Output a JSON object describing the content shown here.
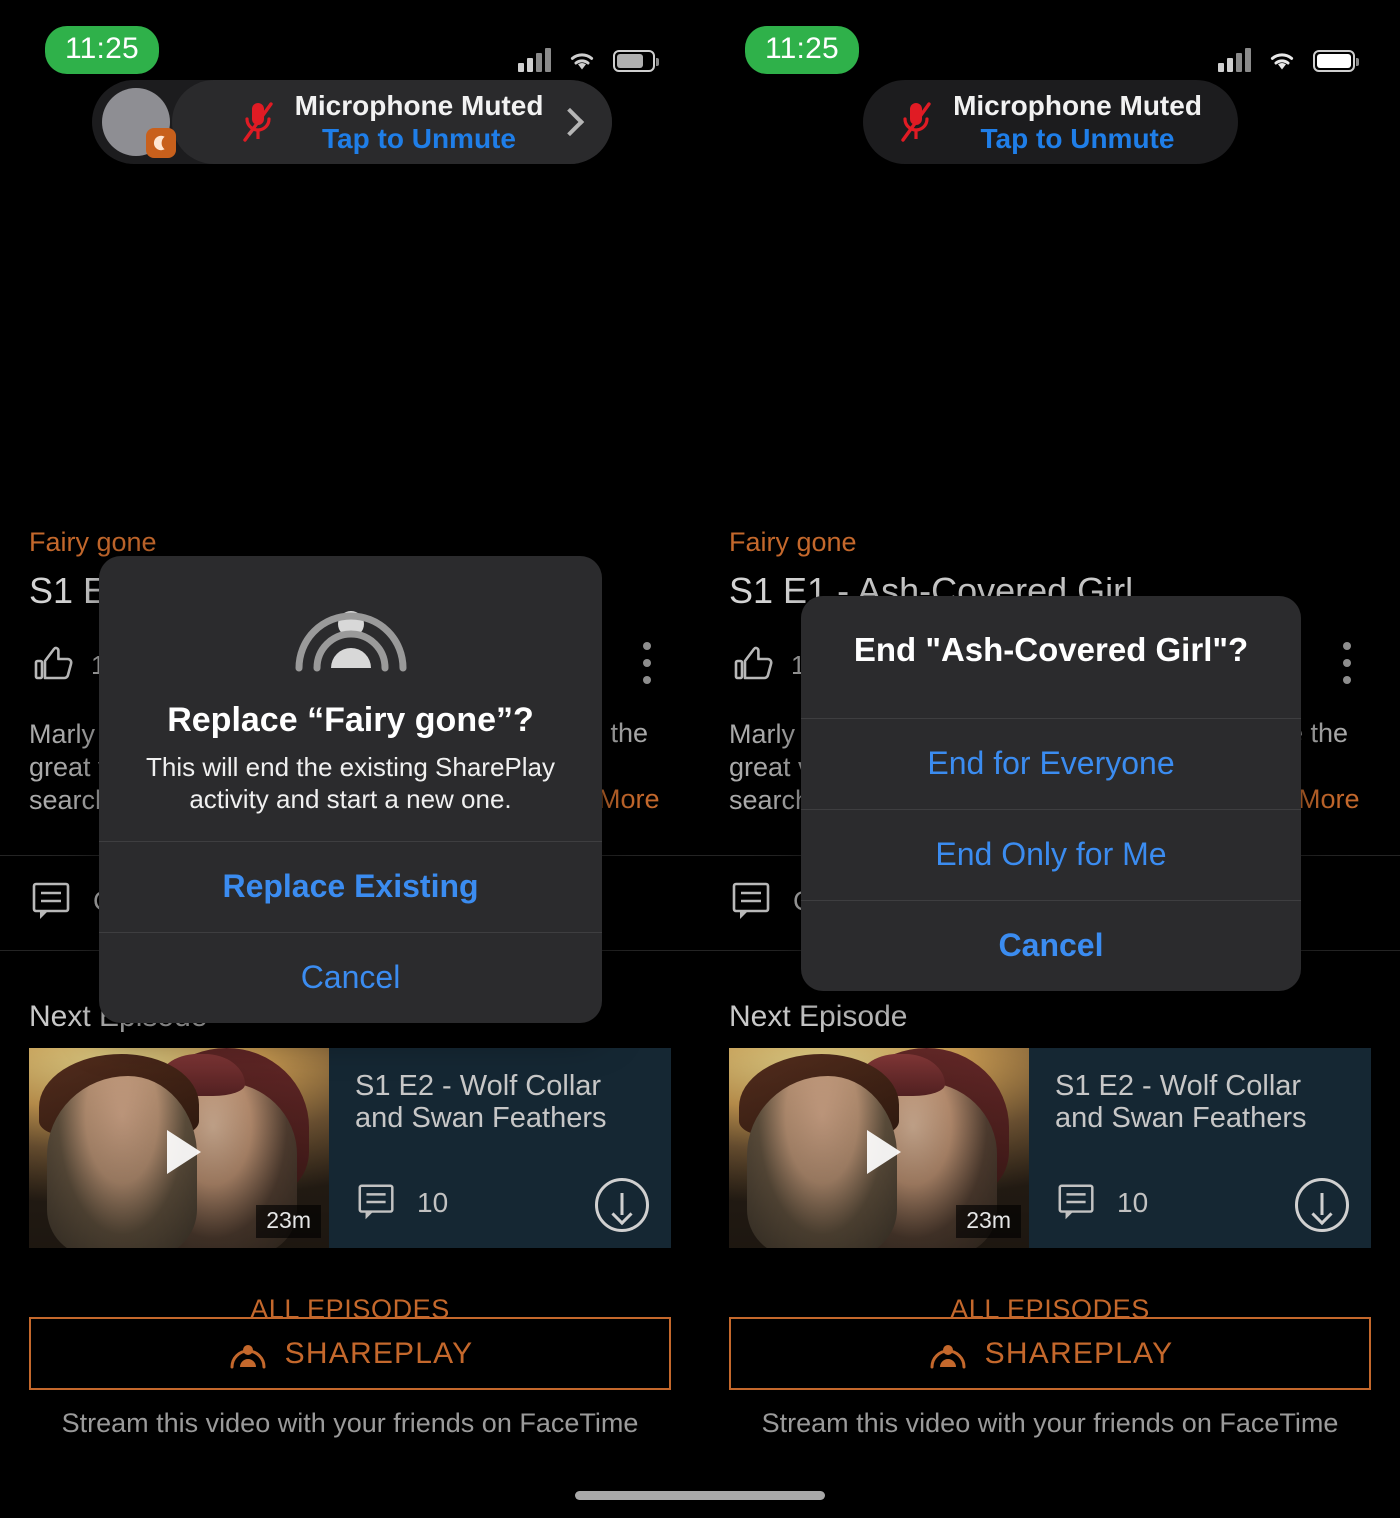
{
  "status_bar": {
    "time": "11:25",
    "icons": [
      "cellular-signal-icon",
      "wifi-icon",
      "battery-icon"
    ]
  },
  "mic_banner": {
    "title": "Microphone Muted",
    "subtitle": "Tap to Unmute",
    "mic_icon": "microphone-muted-icon",
    "chevron_icon": "chevron-right-icon",
    "avatar_badge_icon": "facetime-shareplay-badge-icon",
    "mic_color": "#e01b24",
    "subtitle_color": "#1f7ee8"
  },
  "content": {
    "show_name": "Fairy gone",
    "episode_title": "S1 E1 - Ash-Covered Girl",
    "thumbs_up_icon": "thumbs-up-icon",
    "thumbs_up_count": "1",
    "kebab_icon": "more-options-icon",
    "description_line1": "Marly",
    "description_line2": "great v",
    "description_line3": "search",
    "description_right1": "e the",
    "description_more": "More",
    "comment_icon": "comment-icon",
    "comment_label": "C",
    "next_episode_heading": "Next Episode",
    "all_episodes": "ALL EPISODES",
    "accent_color": "#c4682c"
  },
  "next_episode_card": {
    "title": "S1 E2 - Wolf Collar and Swan Feathers",
    "duration": "23m",
    "comment_count": "10",
    "play_icon": "play-icon",
    "comment_icon": "comment-icon",
    "download_icon": "download-icon"
  },
  "shareplay": {
    "button_label": "SHAREPLAY",
    "button_icon": "shareplay-icon",
    "caption": "Stream this video with your friends on FaceTime"
  },
  "left_alert": {
    "icon": "shareplay-icon",
    "title": "Replace “Fairy gone”?",
    "message": "This will end the existing SharePlay activity and start a new one.",
    "buttons": [
      {
        "label": "Replace Existing",
        "emphasis": "bold"
      },
      {
        "label": "Cancel",
        "emphasis": "normal"
      }
    ]
  },
  "right_alert": {
    "title": "End \"Ash-Covered Girl\"?",
    "buttons": [
      {
        "label": "End for Everyone",
        "emphasis": "normal"
      },
      {
        "label": "End Only for Me",
        "emphasis": "normal"
      },
      {
        "label": "Cancel",
        "emphasis": "bold"
      }
    ]
  },
  "home_indicator": "home-indicator"
}
